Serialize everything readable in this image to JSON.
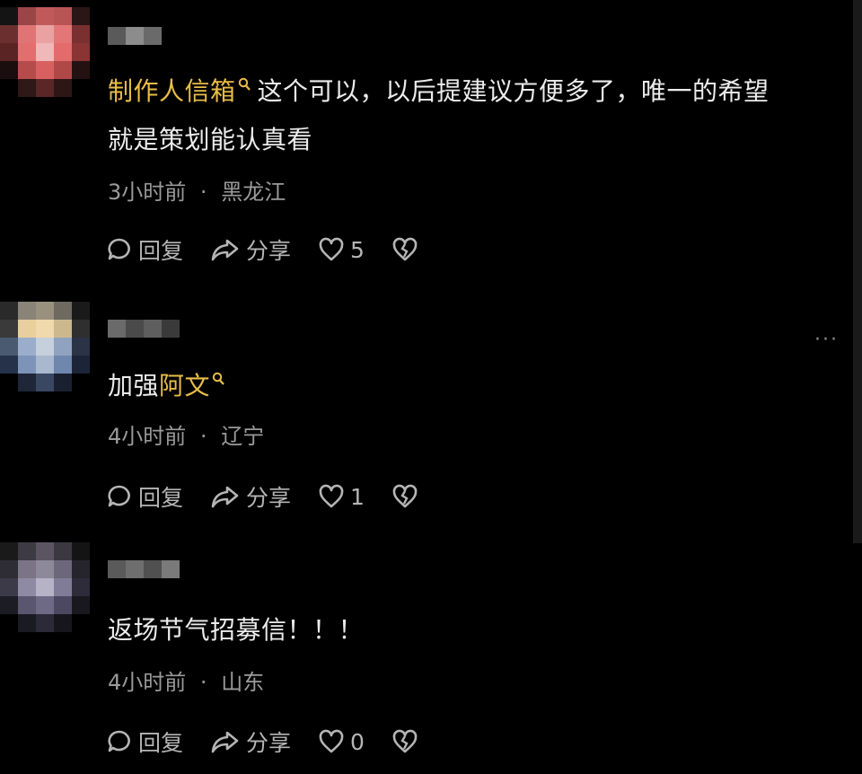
{
  "comments": [
    {
      "mention": "制作人信箱",
      "text_rest": "这个可以，以后提建议方便多了，唯一的希望",
      "text_line2": "就是策划能认真看",
      "time": "3小时前",
      "sep": "·",
      "location": "黑龙江",
      "reply_label": "回复",
      "share_label": "分享",
      "likes": "5"
    },
    {
      "text_prefix": "加强",
      "mention": "阿文",
      "time": "4小时前",
      "sep": "·",
      "location": "辽宁",
      "reply_label": "回复",
      "share_label": "分享",
      "likes": "1",
      "more": "···"
    },
    {
      "text": "返场节气招募信！！！",
      "time": "4小时前",
      "sep": "·",
      "location": "山东",
      "reply_label": "回复",
      "share_label": "分享",
      "likes": "0"
    }
  ],
  "colors": {
    "highlight": "#e9bd49",
    "background": "#000000",
    "meta": "#9a9a9a"
  },
  "icons": [
    "comment-bubble-icon",
    "share-arrow-icon",
    "heart-icon",
    "broken-heart-icon",
    "search-icon",
    "more-icon"
  ]
}
